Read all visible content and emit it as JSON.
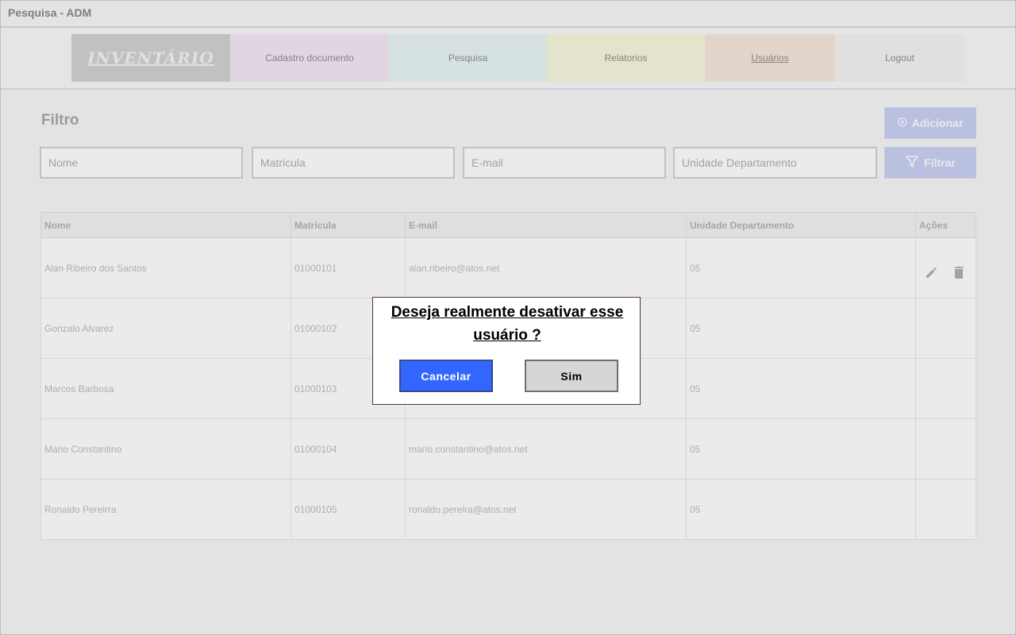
{
  "window": {
    "title": "Pesquisa - ADM"
  },
  "nav": {
    "logo": "INVENTÁRIO",
    "items": [
      {
        "label": "Cadastro documento"
      },
      {
        "label": "Pesquisa"
      },
      {
        "label": "Relatorios"
      },
      {
        "label": "Usuários"
      },
      {
        "label": "Logout"
      }
    ]
  },
  "filter": {
    "title": "Filtro",
    "add_label": "Adicionar",
    "filter_label": "Filtrar",
    "placeholders": {
      "nome": "Nome",
      "matricula": "Matricula",
      "email": "E-mail",
      "unidade": "Unidade Departamento"
    }
  },
  "table": {
    "headers": [
      "Nome",
      "Matricula",
      "E-mail",
      "Unidade Departamento",
      "Ações"
    ],
    "rows": [
      {
        "nome": "Alan Ribeiro dos Santos",
        "matricula": "01000101",
        "email": "alan.ribeiro@atos.net",
        "unidade": "05"
      },
      {
        "nome": "Gonzalo Alvarez",
        "matricula": "01000102",
        "email": "",
        "unidade": "05"
      },
      {
        "nome": "Marcos Barbosa",
        "matricula": "01000103",
        "email": "",
        "unidade": "05"
      },
      {
        "nome": "Mario Constantino",
        "matricula": "01000104",
        "email": "mario.constantino@atos.net",
        "unidade": "05"
      },
      {
        "nome": "Ronaldo Pereirra",
        "matricula": "01000105",
        "email": "ronaldo.pereira@atos.net",
        "unidade": "05"
      }
    ]
  },
  "modal": {
    "message": "Deseja realmente desativar esse usuário ?",
    "cancel_label": "Cancelar",
    "confirm_label": "Sim"
  },
  "colors": {
    "primary": "#3366ff",
    "modal_border": "#5b2a5b"
  }
}
